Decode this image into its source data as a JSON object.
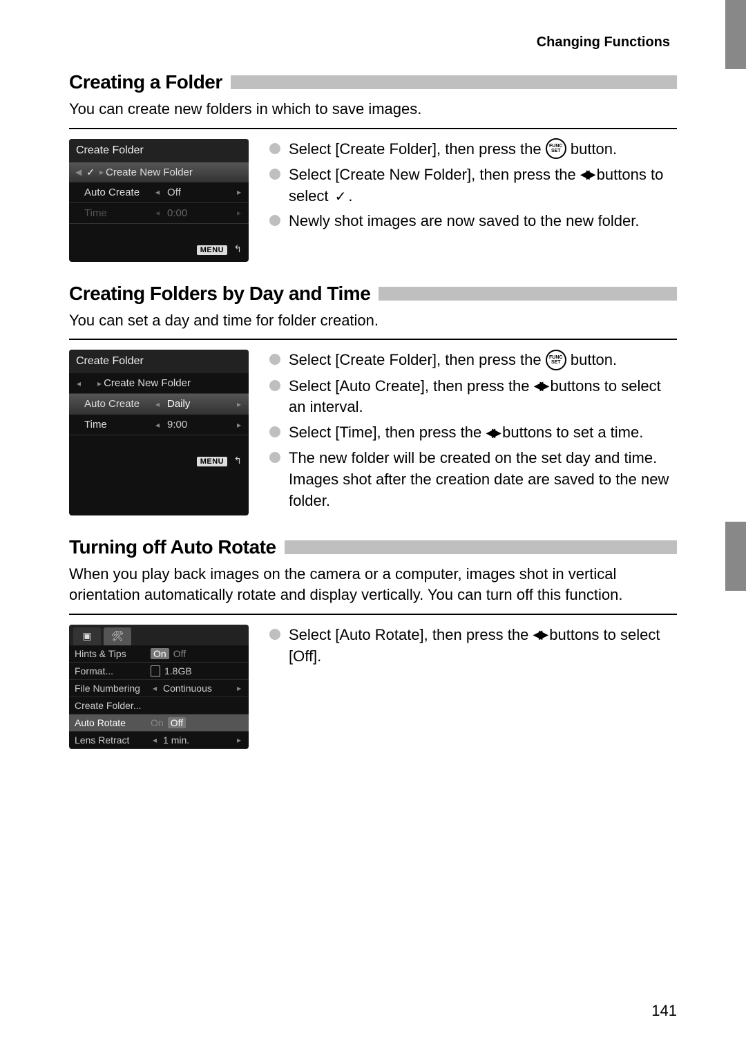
{
  "header": "Changing Functions",
  "page_number": "141",
  "section1": {
    "title": "Creating a Folder",
    "intro": "You can create new folders in which to save images.",
    "screenshot": {
      "title": "Create Folder",
      "create_new": "Create New Folder",
      "auto_create_label": "Auto Create",
      "auto_create_value": "Off",
      "time_label": "Time",
      "time_value": "0:00",
      "menu": "MENU"
    },
    "steps": {
      "s1a": "Select [Create Folder], then press the ",
      "s1b": " button.",
      "s2a": "Select [Create New Folder], then press the ",
      "s2b": " buttons to select ",
      "s2c": ".",
      "s3": "Newly shot images are now saved to the new folder."
    }
  },
  "section2": {
    "title": "Creating Folders by Day and Time",
    "intro": "You can set a day and time for folder creation.",
    "screenshot": {
      "title": "Create Folder",
      "create_new": "Create New Folder",
      "auto_create_label": "Auto Create",
      "auto_create_value": "Daily",
      "time_label": "Time",
      "time_value": "9:00",
      "menu": "MENU"
    },
    "steps": {
      "s1a": "Select [Create Folder], then press the ",
      "s1b": " button.",
      "s2a": "Select [Auto Create], then press the ",
      "s2b": " buttons to select an interval.",
      "s3a": "Select [Time], then press the ",
      "s3b": " buttons to set a time.",
      "s4": "The new folder will be created on the set day and time. Images shot after the creation date are saved to the new folder."
    }
  },
  "section3": {
    "title": "Turning off Auto Rotate",
    "intro": "When you play back images on the camera or a computer, images shot in vertical orientation automatically rotate and display vertically. You can turn off this function.",
    "screenshot": {
      "hints_label": "Hints & Tips",
      "hints_on": "On",
      "hints_off": "Off",
      "format_label": "Format...",
      "format_value": "1.8GB",
      "filenum_label": "File Numbering",
      "filenum_value": "Continuous",
      "createfolder_label": "Create Folder...",
      "autorotate_label": "Auto Rotate",
      "autorotate_on": "On",
      "autorotate_off": "Off",
      "lensretract_label": "Lens Retract",
      "lensretract_value": "1 min."
    },
    "steps": {
      "s1a": "Select [Auto Rotate], then press the ",
      "s1b": " buttons to select [Off]."
    }
  }
}
